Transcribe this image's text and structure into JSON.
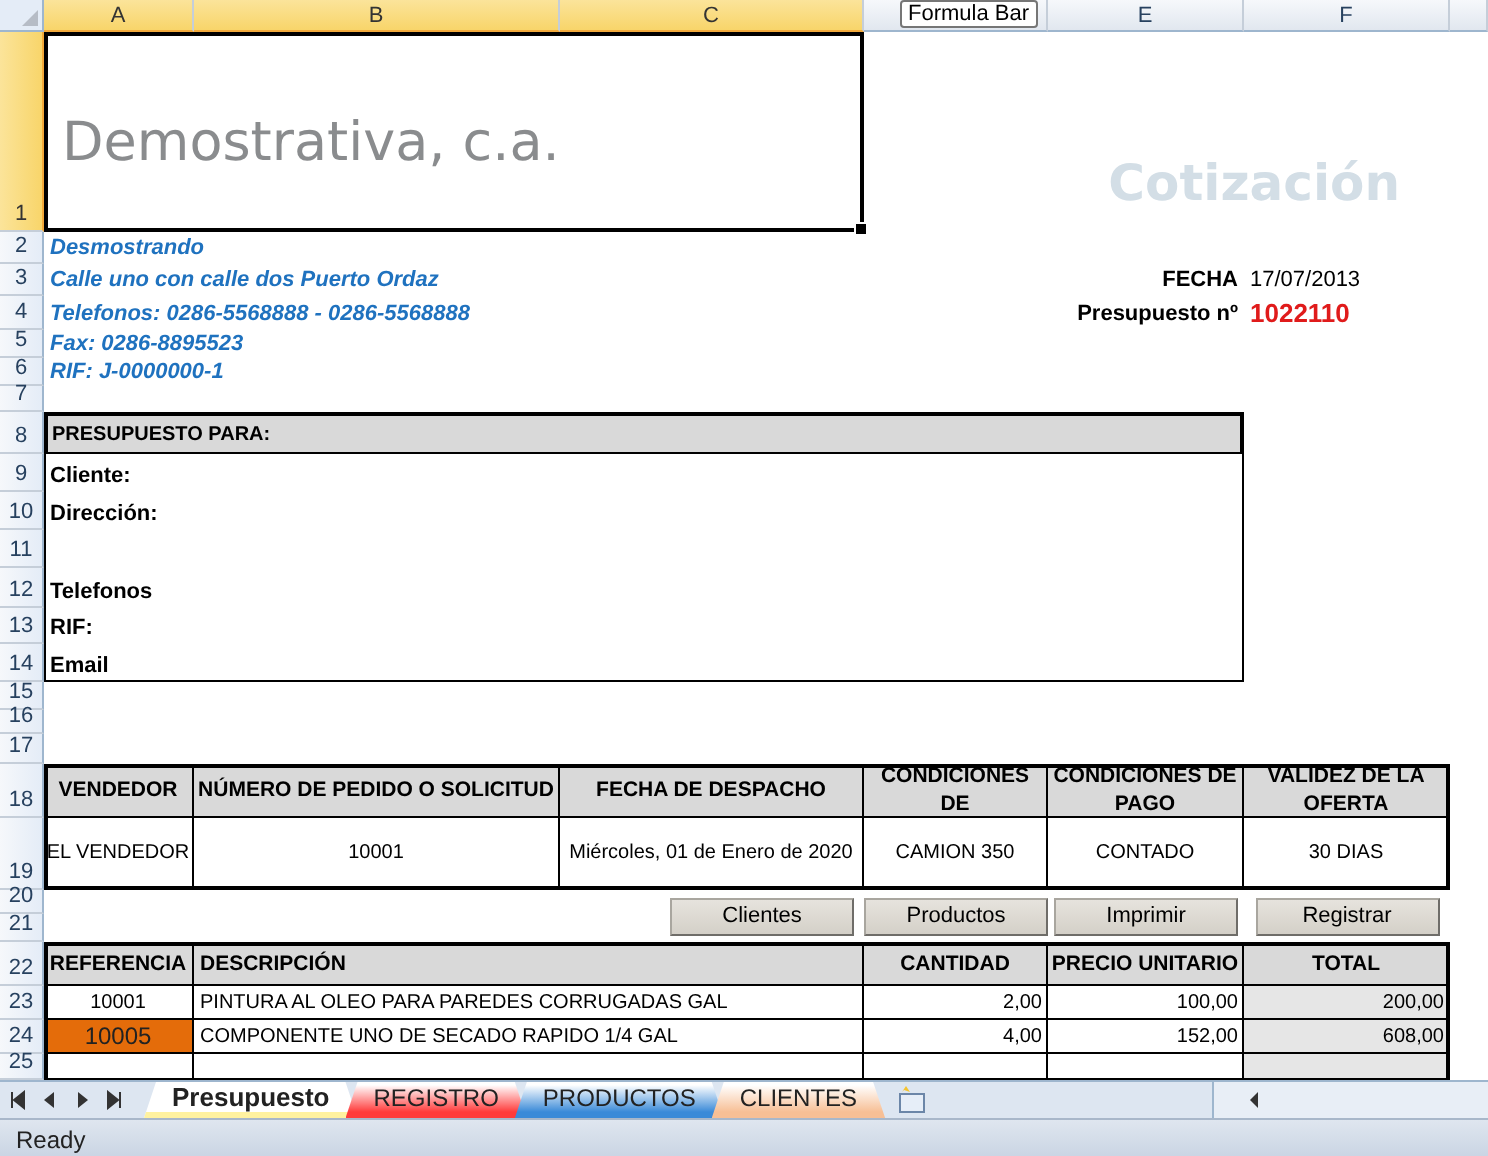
{
  "column_headers": [
    {
      "label": "A",
      "selected": true
    },
    {
      "label": "B",
      "selected": true
    },
    {
      "label": "C",
      "selected": true
    },
    {
      "label": "E",
      "selected": false
    },
    {
      "label": "F",
      "selected": false
    }
  ],
  "tooltip": "Formula Bar",
  "row_headers": [
    {
      "label": "1",
      "selected": true
    },
    {
      "label": "2",
      "selected": false
    },
    {
      "label": "3",
      "selected": false
    },
    {
      "label": "4",
      "selected": false
    },
    {
      "label": "5",
      "selected": false
    },
    {
      "label": "6",
      "selected": false
    },
    {
      "label": "7",
      "selected": false
    },
    {
      "label": "8",
      "selected": false
    },
    {
      "label": "9",
      "selected": false
    },
    {
      "label": "10",
      "selected": false
    },
    {
      "label": "11",
      "selected": false
    },
    {
      "label": "12",
      "selected": false
    },
    {
      "label": "13",
      "selected": false
    },
    {
      "label": "14",
      "selected": false
    },
    {
      "label": "15",
      "selected": false
    },
    {
      "label": "16",
      "selected": false
    },
    {
      "label": "17",
      "selected": false
    },
    {
      "label": "18",
      "selected": false
    },
    {
      "label": "19",
      "selected": false
    },
    {
      "label": "20",
      "selected": false
    },
    {
      "label": "21",
      "selected": false
    },
    {
      "label": "22",
      "selected": false
    },
    {
      "label": "23",
      "selected": false
    },
    {
      "label": "24",
      "selected": false
    },
    {
      "label": "25",
      "selected": false
    }
  ],
  "company_name": "Demostrativa, c.a.",
  "doc_title": "Cotización",
  "company_info": [
    "Desmostrando",
    "Calle uno con calle dos Puerto Ordaz",
    "Telefonos: 0286-5568888 - 0286-5568888",
    "Fax: 0286-8895523",
    "RIF: J-0000000-1"
  ],
  "fecha_label": "FECHA",
  "fecha": "17/07/2013",
  "presupuesto_label": "Presupuesto nº",
  "presupuesto_number": "1022110",
  "client_box": {
    "title": "PRESUPUESTO PARA:",
    "fields": [
      "Cliente:",
      "Dirección:",
      "Telefonos",
      "RIF:",
      "Email"
    ]
  },
  "order_table": {
    "columns": [
      "VENDEDOR",
      "NÚMERO DE PEDIDO O SOLICITUD",
      "FECHA DE DESPACHO",
      "CONDICIONES DE",
      "CONDICIONES DE PAGO",
      "VALIDEZ DE LA OFERTA"
    ],
    "values": [
      "EL VENDEDOR",
      "10001",
      "Miércoles, 01 de Enero de 2020",
      "CAMION  350",
      "CONTADO",
      "30 DIAS"
    ]
  },
  "buttons": [
    "Clientes",
    "Productos",
    "Imprimir",
    "Registrar"
  ],
  "items_table": {
    "columns": [
      "REFERENCIA",
      "DESCRIPCIÓN",
      "CANTIDAD",
      "PRECIO UNITARIO",
      "TOTAL"
    ],
    "rows": [
      {
        "referencia": "10001",
        "descripcion": "PINTURA AL OLEO PARA PAREDES CORRUGADAS GAL",
        "cantidad": "2,00",
        "precio": "100,00",
        "total": "200,00",
        "highlighted": false
      },
      {
        "referencia": "10005",
        "descripcion": "COMPONENTE UNO DE SECADO RAPIDO 1/4 GAL",
        "cantidad": "4,00",
        "precio": "152,00",
        "total": "608,00",
        "highlighted": true
      }
    ]
  },
  "sheet_tabs": [
    {
      "label": "Presupuesto",
      "selected": true,
      "color": "#fff2a0"
    },
    {
      "label": "REGISTRO",
      "selected": false,
      "color": "#ff3b3b"
    },
    {
      "label": "PRODUCTOS",
      "selected": false,
      "color": "#3a8ad8"
    },
    {
      "label": "CLIENTES",
      "selected": false,
      "color": "#f7bf95"
    }
  ],
  "status": "Ready"
}
